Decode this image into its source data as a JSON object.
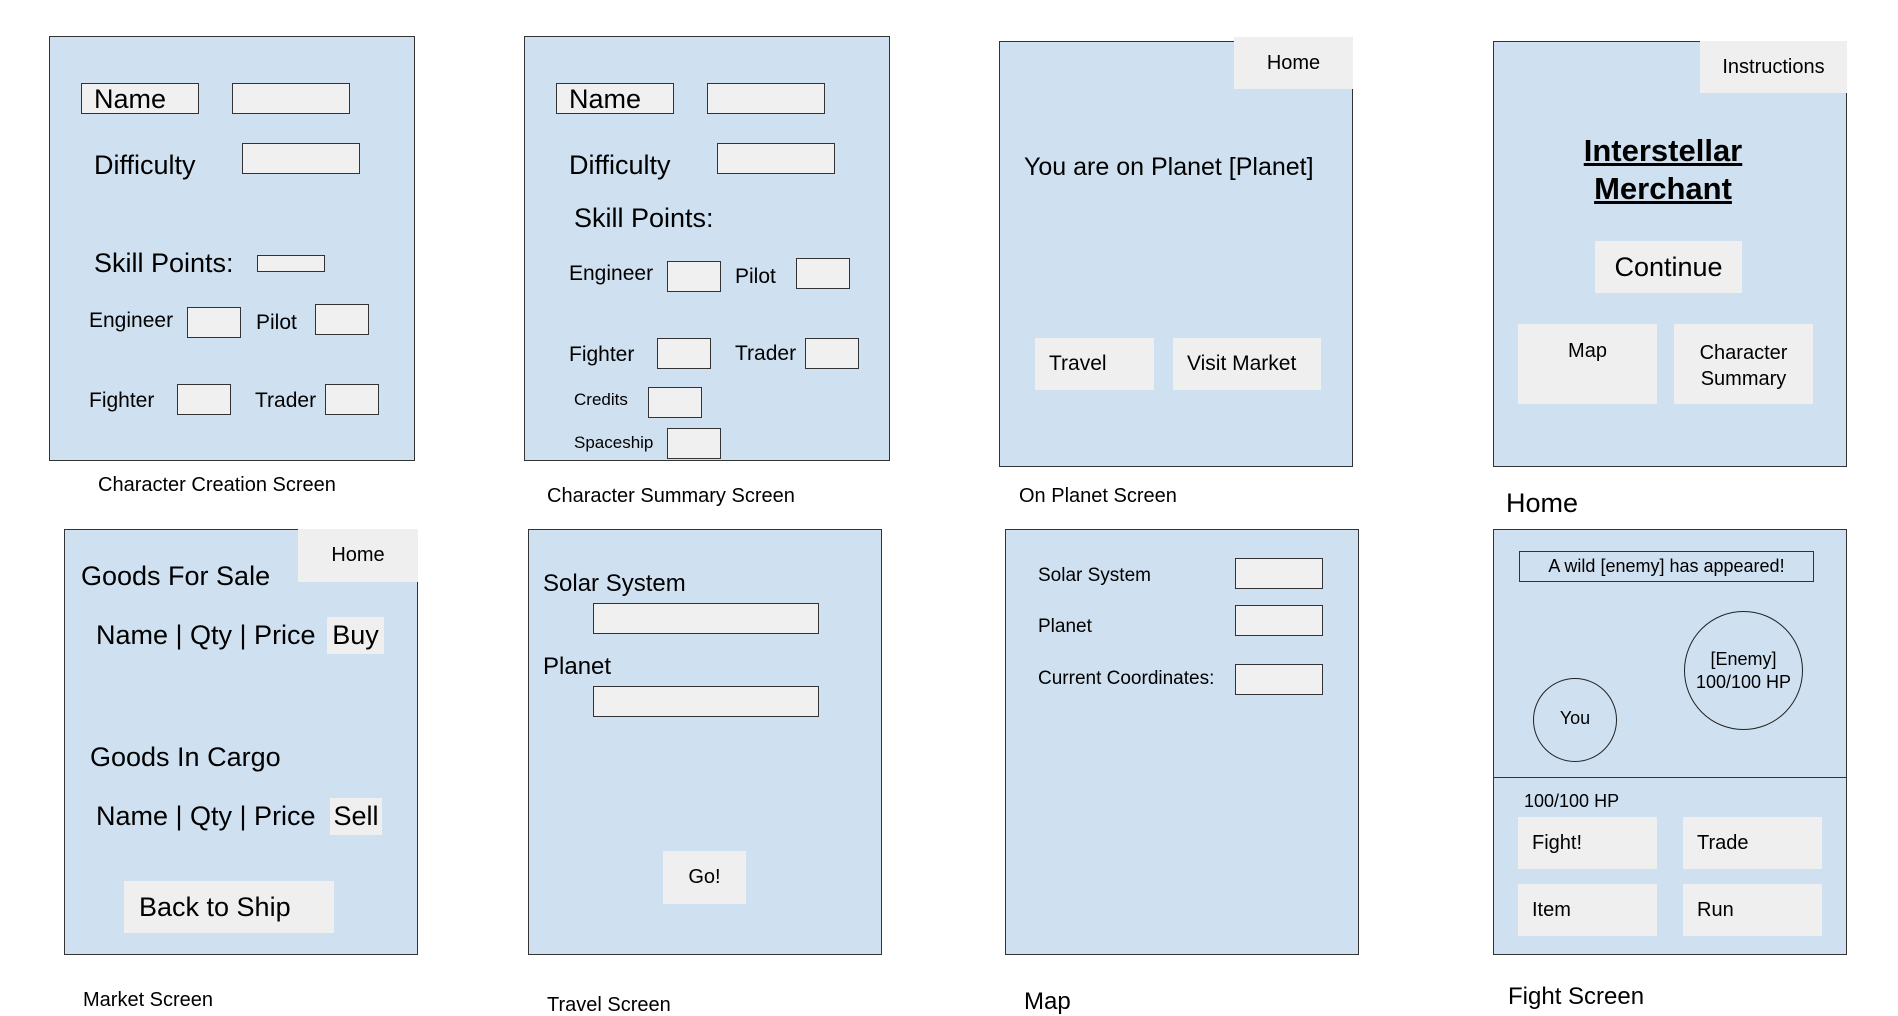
{
  "screens": {
    "character_creation": {
      "caption": "Character Creation Screen",
      "name_label": "Name",
      "difficulty_label": "Difficulty",
      "skill_points_label": "Skill Points:",
      "engineer_label": "Engineer",
      "pilot_label": "Pilot",
      "fighter_label": "Fighter",
      "trader_label": "Trader"
    },
    "character_summary": {
      "caption": "Character Summary Screen",
      "name_label": "Name",
      "difficulty_label": "Difficulty",
      "skill_points_label": "Skill Points:",
      "engineer_label": "Engineer",
      "pilot_label": "Pilot",
      "fighter_label": "Fighter",
      "trader_label": "Trader",
      "credits_label": "Credits",
      "spaceship_label": "Spaceship"
    },
    "on_planet": {
      "caption": "On Planet Screen",
      "home_button": "Home",
      "planet_text": "You are on Planet [Planet]",
      "travel_button": "Travel",
      "visit_market_button": "Visit Market"
    },
    "home": {
      "caption": "Home",
      "instructions_button": "Instructions",
      "title_line1": "Interstellar",
      "title_line2": "Merchant",
      "continue_button": "Continue",
      "map_button": "Map",
      "character_summary_line1": "Character",
      "character_summary_line2": "Summary"
    },
    "market": {
      "caption": "Market Screen",
      "home_button": "Home",
      "goods_for_sale": "Goods For Sale",
      "sale_row": "Name | Qty | Price",
      "buy_button": "Buy",
      "goods_in_cargo": "Goods In Cargo",
      "cargo_row": "Name | Qty | Price",
      "sell_button": "Sell",
      "back_button": "Back to Ship"
    },
    "travel": {
      "caption": "Travel Screen",
      "solar_system_label": "Solar System",
      "planet_label": "Planet",
      "go_button": "Go!"
    },
    "map": {
      "caption": "Map",
      "solar_system_label": "Solar System",
      "planet_label": "Planet",
      "coordinates_label": "Current Coordinates:"
    },
    "fight": {
      "caption": "Fight Screen",
      "announcement": "A wild [enemy] has appeared!",
      "enemy_line1": "[Enemy]",
      "enemy_line2": "100/100 HP",
      "you_label": "You",
      "player_hp": "100/100 HP",
      "fight_button": "Fight!",
      "trade_button": "Trade",
      "item_button": "Item",
      "run_button": "Run"
    }
  }
}
